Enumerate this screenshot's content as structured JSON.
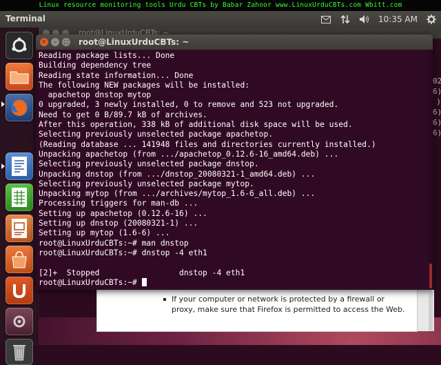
{
  "banner": {
    "text": "Linux resource monitoring tools Urdu CBTs by Babar Zahoor www.LinuxUrduCBTs.com Wbitt.com"
  },
  "panel": {
    "app_title": "Terminal",
    "clock": "10:35 AM"
  },
  "icons": [
    "mail-icon",
    "network-icon",
    "volume-icon",
    "gear-icon"
  ],
  "background_terminal": {
    "title": "root@LinuxUrduCBTs: ~",
    "right_edge": [
      "02",
      "6)",
      ")",
      "6)",
      "6)",
      "6)"
    ]
  },
  "terminal": {
    "title": "root@LinuxUrduCBTs: ~",
    "lines": [
      "Reading package lists... Done",
      "Building dependency tree",
      "Reading state information... Done",
      "The following NEW packages will be installed:",
      "  apachetop dnstop mytop",
      "0 upgraded, 3 newly installed, 0 to remove and 523 not upgraded.",
      "Need to get 0 B/89.7 kB of archives.",
      "After this operation, 338 kB of additional disk space will be used.",
      "Selecting previously unselected package apachetop.",
      "(Reading database ... 141948 files and directories currently installed.)",
      "Unpacking apachetop (from .../apachetop_0.12.6-16_amd64.deb) ...",
      "Selecting previously unselected package dnstop.",
      "Unpacking dnstop (from .../dnstop_20080321-1_amd64.deb) ...",
      "Selecting previously unselected package mytop.",
      "Unpacking mytop (from .../archives/mytop_1.6-6_all.deb) ...",
      "Processing triggers for man-db ...",
      "Setting up apachetop (0.12.6-16) ...",
      "Setting up dnstop (20080321-1) ...",
      "Setting up mytop (1.6-6) ...",
      "root@LinuxUrduCBTs:~# man dnstop",
      "root@LinuxUrduCBTs:~# dnstop -4 eth1",
      "",
      "[2]+  Stopped                 dnstop -4 eth1"
    ],
    "prompt": "root@LinuxUrduCBTs:~# "
  },
  "firefox_page": {
    "bullet_text": "If your computer or network is protected by a firewall or proxy, make sure that Firefox is permitted to access the Web."
  }
}
